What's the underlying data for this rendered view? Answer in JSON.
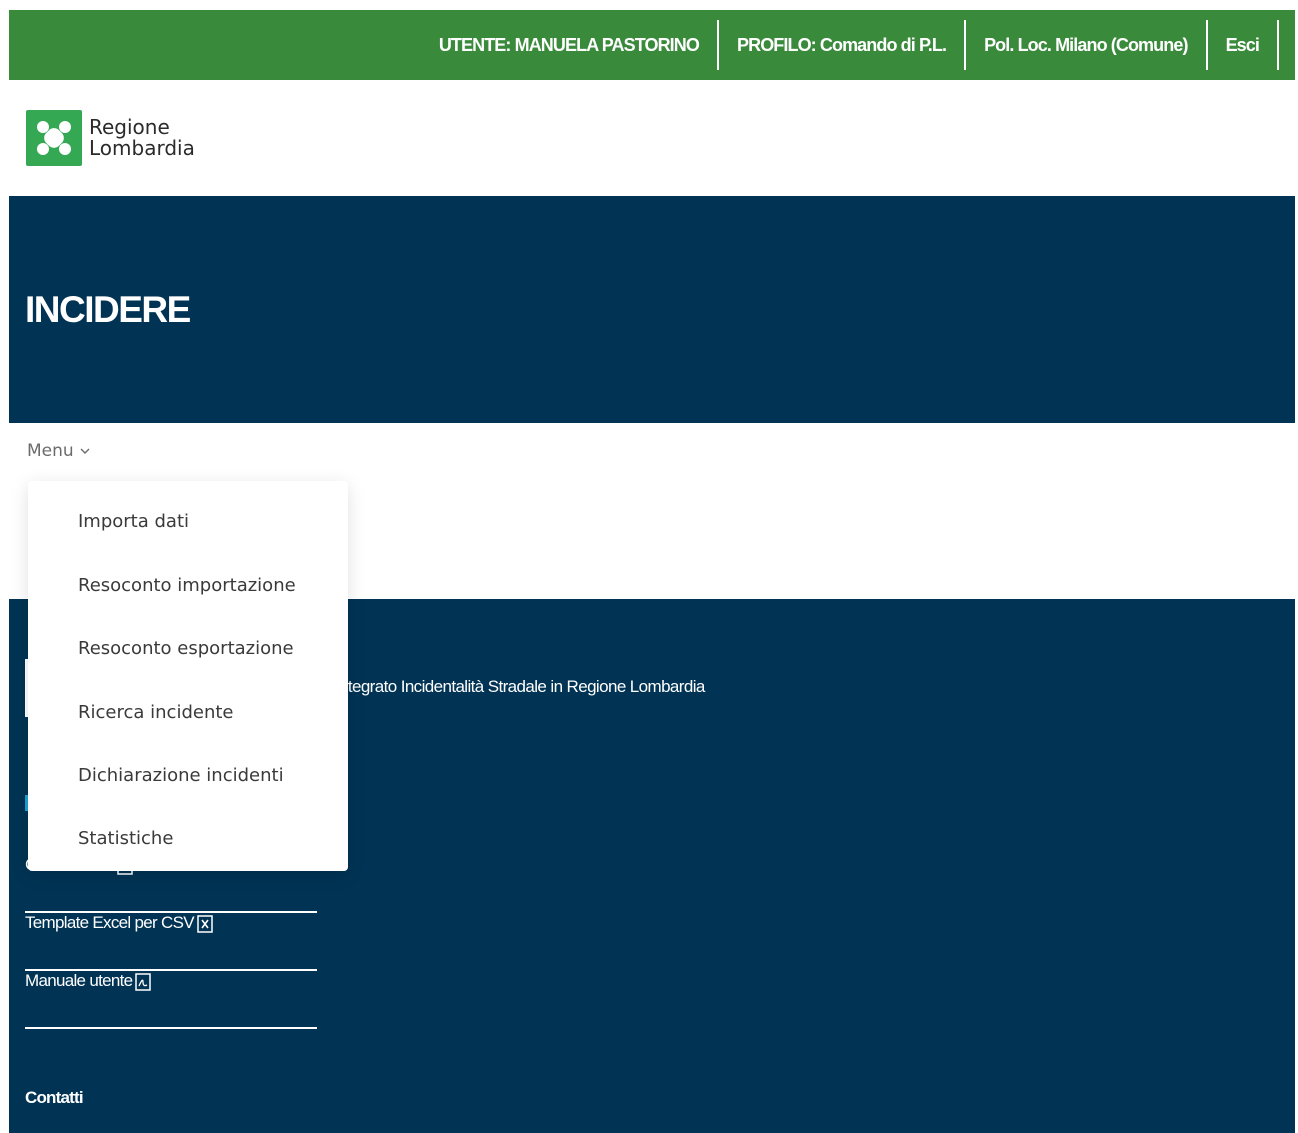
{
  "header": {
    "user": "UTENTE: MANUELA PASTORINO",
    "profile": "PROFILO: Comando di P.L.",
    "entity": "Pol. Loc. Milano (Comune)",
    "logout": "Esci"
  },
  "logo": {
    "line1": "Regione",
    "line2": "Lombardia"
  },
  "hero": {
    "title": "INCIDERE"
  },
  "menu": {
    "toggle_label": "Menu",
    "items": [
      "Importa dati",
      "Resoconto importazione",
      "Resoconto esportazione",
      "Ricerca incidente",
      "Dichiarazione incidenti",
      "Statistiche"
    ]
  },
  "footer": {
    "description": "ntegrato Incidentalità Stradale in Regione Lombardia",
    "links": [
      {
        "label": "Codici ISTAT",
        "icon": "pdf-icon"
      },
      {
        "label": "Template Excel per CSV",
        "icon": "excel-icon"
      },
      {
        "label": "Manuale utente",
        "icon": "pdf-icon"
      }
    ],
    "contacts": "Contatti"
  },
  "colors": {
    "topbar": "#3a8a3c",
    "navy": "#003354",
    "logo_green": "#34a853"
  }
}
